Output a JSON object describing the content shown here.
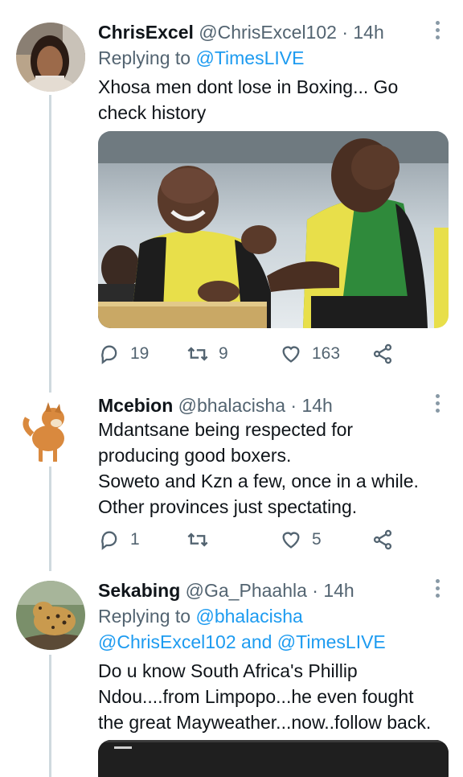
{
  "tweets": [
    {
      "name": "ChrisExcel",
      "handle": "@ChrisExcel102",
      "dot": "·",
      "time": "14h",
      "replying_prefix": "Replying to",
      "replying_to": "@TimesLIVE",
      "lines": [
        "Xhosa men dont lose in Boxing... Go",
        "check history"
      ],
      "replies": "19",
      "retweets": "9",
      "likes": "163"
    },
    {
      "name": "Mcebion",
      "handle": "@bhalacisha",
      "dot": "·",
      "time": "14h",
      "lines": [
        "Mdantsane being respected for",
        "producing good boxers.",
        "Soweto and Kzn a few, once in a while.",
        "Other provinces just spectating."
      ],
      "replies": "1",
      "retweets": "",
      "likes": "5"
    },
    {
      "name": "Sekabing",
      "handle": "@Ga_Phaahla",
      "dot": "·",
      "time": "14h",
      "replying_prefix": "Replying to",
      "replying_to_line1": "@bhalacisha",
      "replying_to_line2_a": "@ChrisExcel102",
      "replying_to_and": "and",
      "replying_to_line2_b": "@TimesLIVE",
      "lines": [
        "Do u know South Africa's Phillip",
        "Ndou....from Limpopo...he even fought",
        "the great Mayweather...now..follow back."
      ]
    }
  ],
  "icons": {
    "reply": "reply-icon",
    "retweet": "retweet-icon",
    "like": "heart-icon",
    "share": "share-icon",
    "more": "more-vertical-icon"
  },
  "colors": {
    "link": "#1d9bf0",
    "secondary": "#536471",
    "thread_line": "#cfd9de"
  }
}
